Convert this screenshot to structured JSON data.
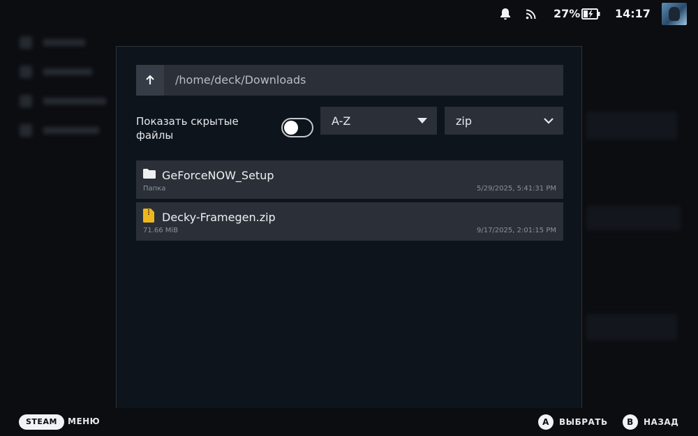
{
  "status": {
    "battery_percent": "27%",
    "time": "14:17"
  },
  "dialog": {
    "path": "/home/deck/Downloads",
    "show_hidden_label": "Показать скрытые файлы",
    "show_hidden_on": false,
    "sort_value": "A-Z",
    "filter_value": "zip",
    "files": [
      {
        "name": "GeForceNOW_Setup",
        "type": "folder",
        "meta": "Папка",
        "date": "5/29/2025, 5:41:31 PM"
      },
      {
        "name": "Decky-Framegen.zip",
        "type": "zip",
        "meta": "71.66 MiB",
        "date": "9/17/2025, 2:01:15 PM"
      }
    ]
  },
  "bottom_bar": {
    "steam_label": "STEAM",
    "menu_label": "МЕНЮ",
    "a_key": "A",
    "a_label": "ВЫБРАТЬ",
    "b_key": "B",
    "b_label": "НАЗАД"
  },
  "colors": {
    "background": "#0b0d11",
    "dialog_bg": "#0e141b",
    "row_bg": "#2b3038",
    "zip_icon": "#f0b61f"
  }
}
